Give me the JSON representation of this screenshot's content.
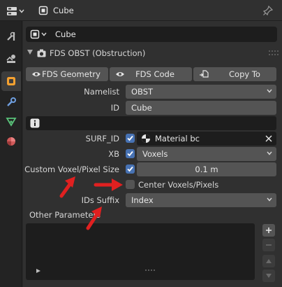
{
  "header": {
    "context_label": "Cube",
    "editor_type_icon": "editor-type-icon",
    "pin_icon": "pin-icon"
  },
  "sidebar": {
    "tabs": [
      {
        "name": "tool-tab",
        "icon": "wrench-screwdriver-icon"
      },
      {
        "name": "render-tab",
        "icon": "camera-back-icon"
      },
      {
        "name": "object-tab",
        "icon": "object-orange-square-icon",
        "active": true
      },
      {
        "name": "modifiers-tab",
        "icon": "wrench-icon"
      },
      {
        "name": "constraints-tab",
        "icon": "constraint-icon"
      },
      {
        "name": "material-tab",
        "icon": "material-sphere-icon"
      }
    ]
  },
  "object_name": "Cube",
  "panel": {
    "title": "FDS OBST (Obstruction)",
    "tabs": [
      {
        "label": "FDS Geometry",
        "icon": "eye-icon"
      },
      {
        "label": "FDS Code",
        "icon": "eye-icon"
      },
      {
        "label": "Copy To",
        "icon": "copy-icon"
      }
    ],
    "namelist": {
      "label": "Namelist",
      "value": "OBST"
    },
    "id": {
      "label": "ID",
      "value": "Cube"
    },
    "info_value": "",
    "surf_id": {
      "label": "SURF_ID",
      "value": "Material bc",
      "checked": true
    },
    "xb": {
      "label": "XB",
      "value": "Voxels",
      "checked": true
    },
    "custom_voxel": {
      "label": "Custom Voxel/Pixel Size",
      "value": "0.1 m",
      "checked": true
    },
    "center_voxels": {
      "label": "Center Voxels/Pixels",
      "checked": false
    },
    "ids_suffix": {
      "label": "IDs Suffix",
      "value": "Index"
    },
    "other_params_label": "Other Parameters"
  },
  "colors": {
    "accent": "#4772b3",
    "annotation_arrow": "#e02020",
    "panel_bg": "#303030",
    "field_bg": "#545454",
    "dark_field_bg": "#1d1d1d"
  }
}
